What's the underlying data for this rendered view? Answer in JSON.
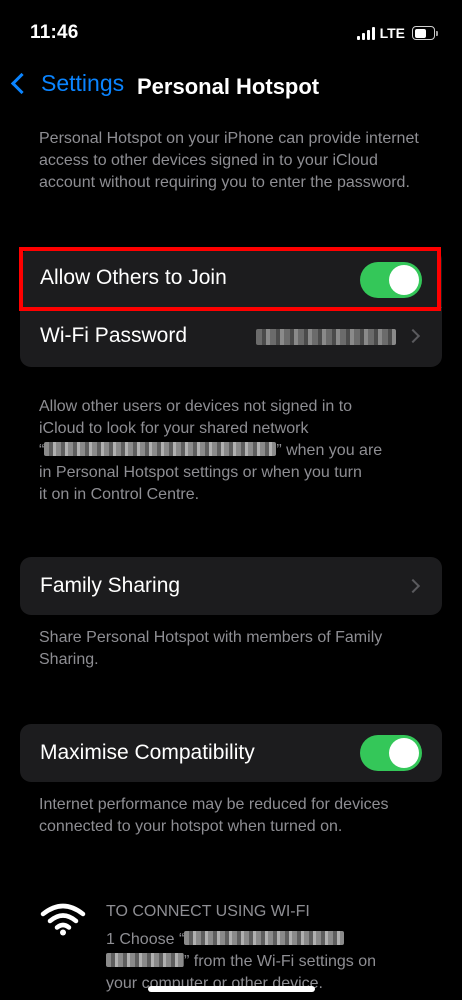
{
  "status_bar": {
    "time": "11:46",
    "network": "LTE",
    "icons": [
      "signal-icon",
      "battery-icon"
    ]
  },
  "nav": {
    "back_label": "Settings",
    "title": "Personal Hotspot"
  },
  "intro_text": "Personal Hotspot on your iPhone can provide internet access to other devices signed in to your iCloud account without requiring you to enter the password.",
  "group_main": {
    "allow_join_label": "Allow Others to Join",
    "allow_join_on": true,
    "wifi_password_label": "Wi-Fi Password"
  },
  "allow_note": {
    "line1": "Allow other users or devices not signed in to",
    "line2_prefix": "iCloud to look for your shared network",
    "line3_open": "“",
    "line3_suffix": "” when you are",
    "line4": "in Personal Hotspot settings or when you turn",
    "line5": "it on in Control Centre."
  },
  "family": {
    "label": "Family Sharing",
    "note": "Share Personal Hotspot with members of Family Sharing."
  },
  "compat": {
    "label": "Maximise Compatibility",
    "on": true,
    "note": "Internet performance may be reduced for devices connected to your hotspot when turned on."
  },
  "connect": {
    "heading": "TO CONNECT USING WI-FI",
    "step_prefix": "1 Choose “",
    "step_middle": "” from the Wi-Fi settings on",
    "step_suffix": "your computer or other device."
  },
  "colors": {
    "accent": "#0a84ff",
    "toggle_on": "#34c759",
    "highlight": "#ff0000",
    "cell_bg": "#1c1c1e"
  }
}
